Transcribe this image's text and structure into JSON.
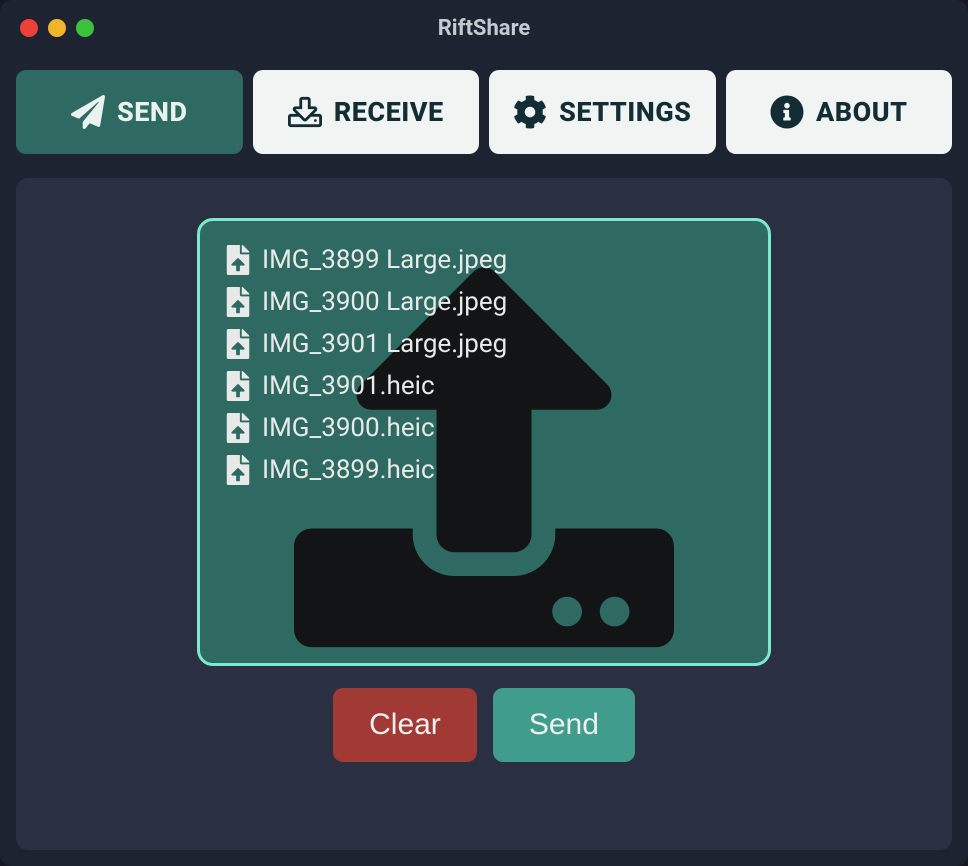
{
  "window": {
    "title": "RiftShare"
  },
  "tabs": {
    "send": "SEND",
    "receive": "RECEIVE",
    "settings": "SETTINGS",
    "about": "ABOUT"
  },
  "files": [
    {
      "name": "IMG_3899 Large.jpeg"
    },
    {
      "name": "IMG_3900 Large.jpeg"
    },
    {
      "name": "IMG_3901 Large.jpeg"
    },
    {
      "name": "IMG_3901.heic"
    },
    {
      "name": "IMG_3900.heic"
    },
    {
      "name": "IMG_3899.heic"
    }
  ],
  "buttons": {
    "clear": "Clear",
    "send": "Send"
  }
}
